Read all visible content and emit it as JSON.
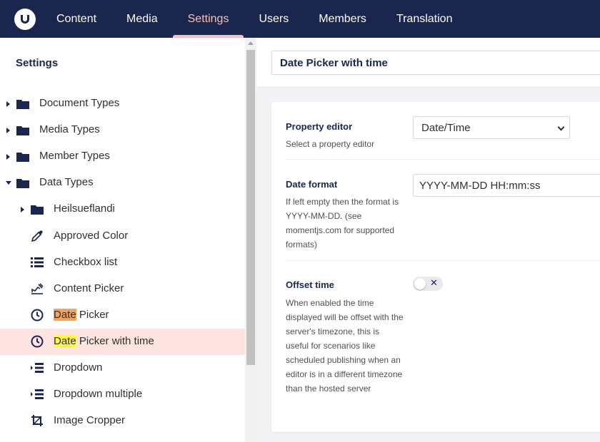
{
  "nav": {
    "items": [
      "Content",
      "Media",
      "Settings",
      "Users",
      "Members",
      "Translation"
    ],
    "active": "Settings"
  },
  "sidebar": {
    "title": "Settings",
    "tree": [
      {
        "label": "Document Types",
        "icon": "folder-icon",
        "caret": "right"
      },
      {
        "label": "Media Types",
        "icon": "folder-icon",
        "caret": "right"
      },
      {
        "label": "Member Types",
        "icon": "folder-icon",
        "caret": "right"
      },
      {
        "label": "Data Types",
        "icon": "folder-icon",
        "caret": "down"
      },
      {
        "label": "Heilsueflandi",
        "icon": "folder-icon",
        "caret": "right"
      },
      {
        "label": "Approved Color",
        "icon": "eyedropper-icon"
      },
      {
        "label": "Checkbox list",
        "icon": "list-icon"
      },
      {
        "label": "Content Picker",
        "icon": "content-picker-icon"
      },
      {
        "label_hl": "Date",
        "label_rest": " Picker",
        "icon": "clock-icon"
      },
      {
        "label_hl": "Date",
        "label_rest": " Picker with time",
        "icon": "clock-icon",
        "selected": true
      },
      {
        "label": "Dropdown",
        "icon": "dropdown-icon"
      },
      {
        "label": "Dropdown multiple",
        "icon": "dropdown-icon"
      },
      {
        "label": "Image Cropper",
        "icon": "crop-icon"
      }
    ]
  },
  "editor": {
    "name": "Date Picker with time",
    "property_editor": {
      "label": "Property editor",
      "description": "Select a property editor",
      "value": "Date/Time"
    },
    "date_format": {
      "label": "Date format",
      "description": "If left empty then the format is YYYY-MM-DD. (see momentjs.com for supported formats)",
      "value": "YYYY-MM-DD HH:mm:ss"
    },
    "offset_time": {
      "label": "Offset time",
      "description": "When enabled the time displayed will be offset with the server's timezone, this is useful for scenarios like scheduled publishing when an editor is in a different timezone than the hosted server",
      "toggle_symbol": "✕",
      "enabled": false
    }
  },
  "colors": {
    "nav_bg": "#1b264f",
    "nav_active": "#f5c1bc",
    "selected_row": "#fde4e1",
    "highlight_orange": "#f5a35c",
    "highlight_yellow": "#fef653"
  }
}
